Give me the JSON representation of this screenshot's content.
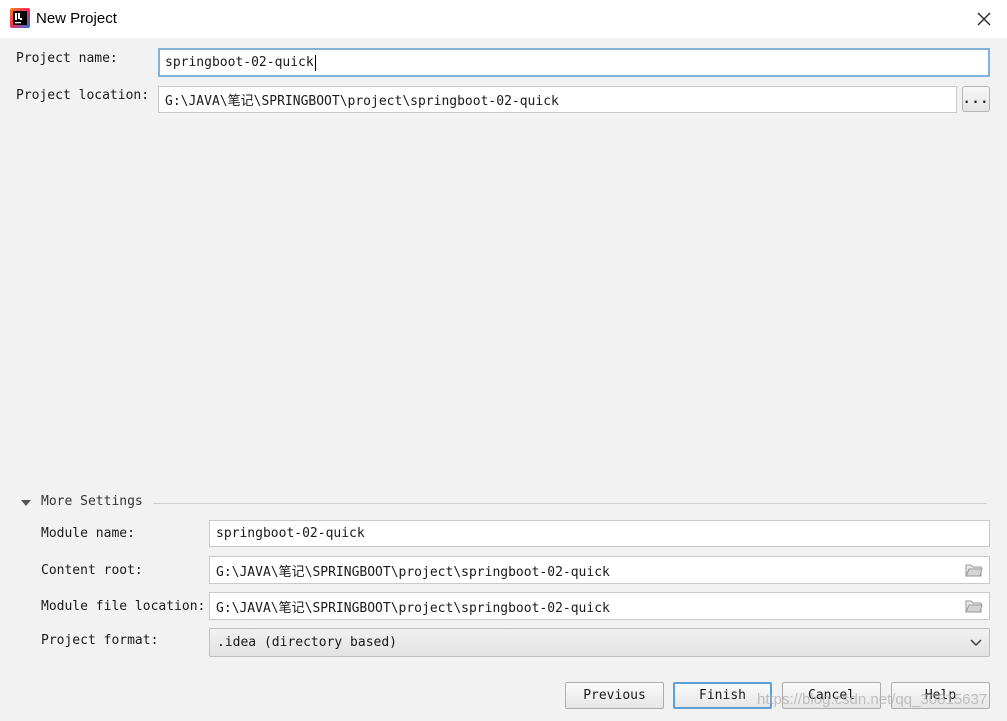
{
  "window": {
    "title": "New Project",
    "app_icon": "intellij-idea-icon",
    "close_icon": "close-icon"
  },
  "project": {
    "name_label": "Project name:",
    "name_value": "springboot-02-quick",
    "location_label": "Project location:",
    "location_value": "G:\\JAVA\\笔记\\SPRINGBOOT\\project\\springboot-02-quick",
    "browse_label": "..."
  },
  "more_settings": {
    "title": "More Settings",
    "module_name_label": "Module name:",
    "module_name_value": "springboot-02-quick",
    "content_root_label": "Content root:",
    "content_root_value": "G:\\JAVA\\笔记\\SPRINGBOOT\\project\\springboot-02-quick",
    "module_file_label": "Module file location:",
    "module_file_value": "G:\\JAVA\\笔记\\SPRINGBOOT\\project\\springboot-02-quick",
    "format_label": "Project format:",
    "format_value": ".idea (directory based)"
  },
  "buttons": {
    "previous": "Previous",
    "finish": "Finish",
    "cancel": "Cancel",
    "help": "Help"
  },
  "watermark": "https://blog.csdn.net/qq_30815637",
  "colors": {
    "background": "#f2f2f2",
    "focus_border": "#7fb3d9",
    "default_button_border": "#5d9fd6"
  }
}
